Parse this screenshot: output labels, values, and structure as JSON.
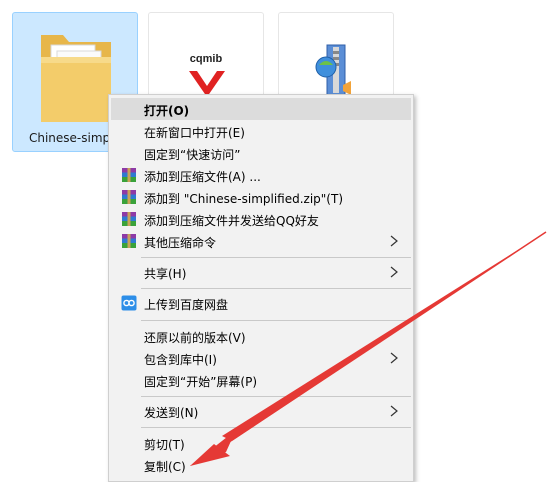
{
  "files": [
    {
      "name": "Chinese-simplif",
      "icon": "folder-icon",
      "selected": true
    },
    {
      "name": "",
      "icon": "cqmib-logo-icon",
      "logo_text": "cqmib"
    },
    {
      "name": "",
      "icon": "zip-archive-icon"
    }
  ],
  "menu": {
    "items": [
      {
        "label": "打开(O)",
        "bold": true
      },
      {
        "label": "在新窗口中打开(E)"
      },
      {
        "label": "固定到“快速访问”"
      },
      {
        "label": "添加到压缩文件(A) ...",
        "icon": "winrar-icon"
      },
      {
        "label": "添加到 \"Chinese-simplified.zip\"(T)",
        "icon": "winrar-icon"
      },
      {
        "label": "添加到压缩文件并发送给QQ好友",
        "icon": "winrar-icon"
      },
      {
        "label": "其他压缩命令",
        "icon": "winrar-icon",
        "submenu": true
      },
      {
        "label": "共享(H)",
        "submenu": true
      },
      {
        "label": "上传到百度网盘",
        "icon": "baidu-netdisk-icon"
      },
      {
        "label": "还原以前的版本(V)"
      },
      {
        "label": "包含到库中(I)",
        "submenu": true
      },
      {
        "label": "固定到“开始”屏幕(P)"
      },
      {
        "label": "发送到(N)",
        "submenu": true
      },
      {
        "label": "剪切(T)"
      },
      {
        "label": "复制(C)"
      }
    ]
  },
  "colors": {
    "selection": "#cce8ff",
    "menu_bg": "#f2f2f2",
    "hover": "#dcdcdc",
    "annotation_arrow": "#e53935"
  }
}
